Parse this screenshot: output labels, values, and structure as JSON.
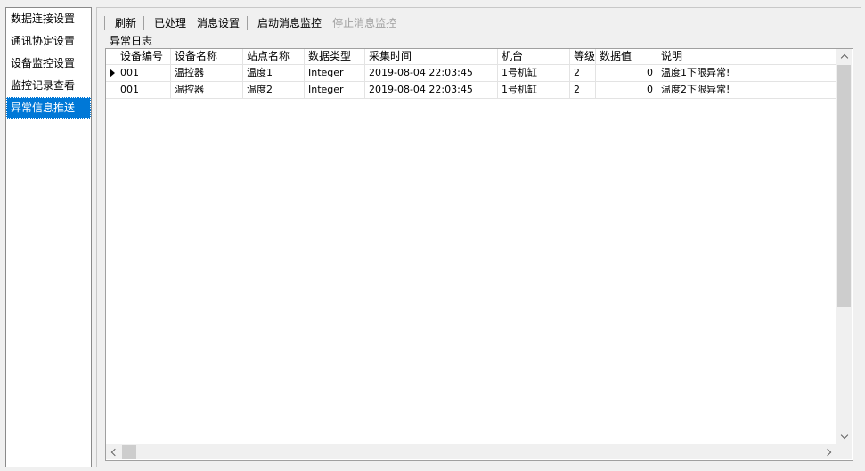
{
  "nav": {
    "items": [
      {
        "label": "数据连接设置"
      },
      {
        "label": "通讯协定设置"
      },
      {
        "label": "设备监控设置"
      },
      {
        "label": "监控记录查看"
      },
      {
        "label": "异常信息推送"
      }
    ],
    "selected_index": 4
  },
  "toolbar": {
    "refresh_label": "刷新",
    "processed_label": "已处理",
    "msg_settings_label": "消息设置",
    "start_monitor_label": "启动消息监控",
    "stop_monitor_label": "停止消息监控"
  },
  "log": {
    "title": "异常日志",
    "columns": [
      "设备编号",
      "设备名称",
      "站点名称",
      "数据类型",
      "采集时间",
      "机台",
      "等级",
      "数据值",
      "说明"
    ],
    "rows": [
      [
        "001",
        "温控器",
        "温度1",
        "Integer",
        "2019-08-04 22:03:45",
        "1号机缸",
        "2",
        "0",
        "温度1下限异常!"
      ],
      [
        "001",
        "温控器",
        "温度2",
        "Integer",
        "2019-08-04 22:03:45",
        "1号机缸",
        "2",
        "0",
        "温度2下限异常!"
      ]
    ],
    "current_row_index": 0
  },
  "colors": {
    "selection": "#0078d7",
    "disabled_text": "#a0a0a0"
  }
}
